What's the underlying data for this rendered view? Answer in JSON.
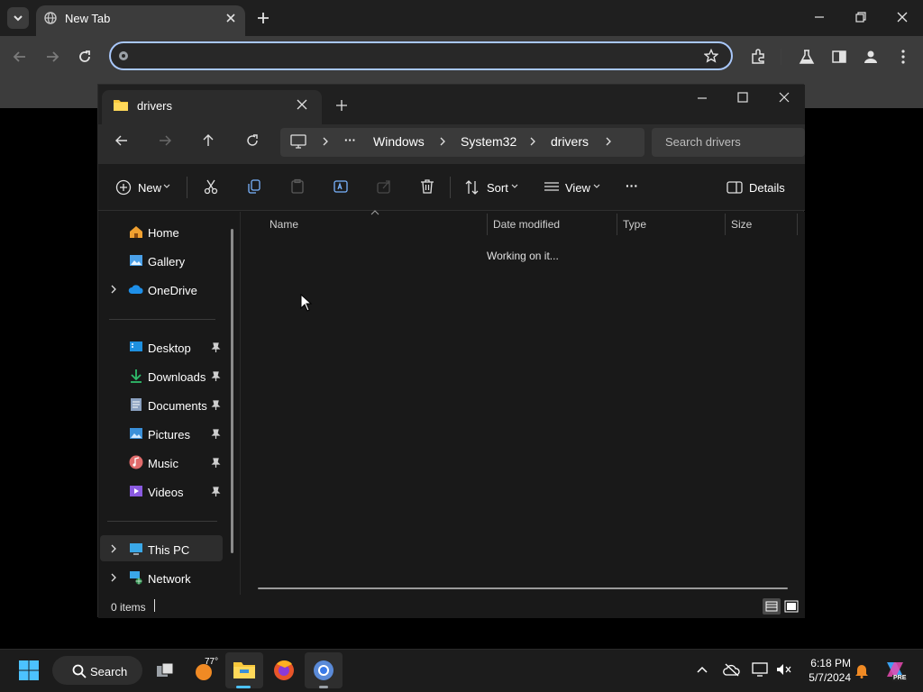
{
  "browser": {
    "tab_title": "New Tab",
    "omnibox_value": ""
  },
  "explorer": {
    "tab_title": "drivers",
    "breadcrumb": {
      "ellipsis": "···",
      "items": [
        "Windows",
        "System32",
        "drivers"
      ]
    },
    "search_placeholder": "Search drivers",
    "commands": {
      "new": "New",
      "sort": "Sort",
      "view": "View",
      "more": "···",
      "details": "Details"
    },
    "sidebar": {
      "top": [
        "Home",
        "Gallery",
        "OneDrive"
      ],
      "pinned": [
        "Desktop",
        "Downloads",
        "Documents",
        "Pictures",
        "Music",
        "Videos"
      ],
      "bottom": [
        "This PC",
        "Network"
      ]
    },
    "columns": [
      "Name",
      "Date modified",
      "Type",
      "Size"
    ],
    "loading_text": "Working on it...",
    "status": "0 items"
  },
  "taskbar": {
    "search_label": "Search",
    "weather_temp": "77°",
    "time": "6:18 PM",
    "date": "5/7/2024",
    "copilot_badge": "PRE"
  },
  "colors": {
    "accent": "#a8c7fa",
    "folder": "#f8c83c",
    "onedrive": "#1e8fe8"
  }
}
